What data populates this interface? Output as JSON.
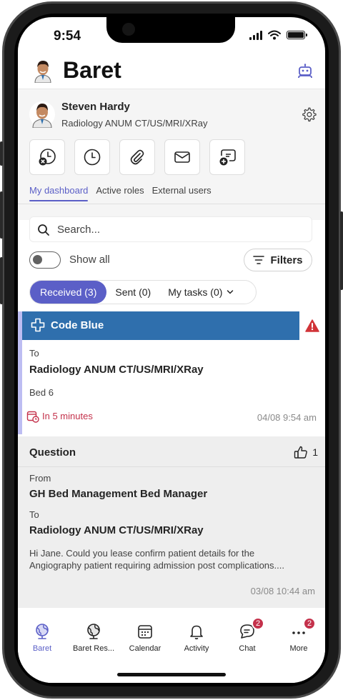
{
  "status_bar": {
    "time": "9:54"
  },
  "header": {
    "title": "Baret"
  },
  "profile": {
    "name": "Steven Hardy",
    "role": "Radiology ANUM CT/US/MRI/XRay"
  },
  "quick_actions": [
    "clock-cancel-icon",
    "clock-icon",
    "paperclip-icon",
    "mail-icon",
    "add-chat-icon"
  ],
  "tabs": [
    {
      "label": "My dashboard",
      "active": true
    },
    {
      "label": "Active roles",
      "active": false
    },
    {
      "label": "External users",
      "active": false
    }
  ],
  "search": {
    "placeholder": "Search..."
  },
  "filters": {
    "show_all_label": "Show all",
    "show_all_on": false,
    "filters_label": "Filters"
  },
  "segments": {
    "received": "Received (3)",
    "sent": "Sent (0)",
    "my_tasks": "My tasks (0)"
  },
  "cards": [
    {
      "title": "Code Blue",
      "header_color": "#2f6fad",
      "to_label": "To",
      "recipient": "Radiology ANUM CT/US/MRI/XRay",
      "detail": "Bed 6",
      "due": "In 5 minutes",
      "timestamp": "04/08 9:54 am"
    },
    {
      "title": "Question",
      "likes": "1",
      "from_label": "From",
      "sender": "GH Bed Management Bed Manager",
      "to_label": "To",
      "recipient": "Radiology ANUM CT/US/MRI/XRay",
      "message": "Hi Jane. Could you lease confirm patient details for the Angiography patient requiring admission post complications....",
      "timestamp": "03/08 10:44 am"
    }
  ],
  "bottom_nav": [
    {
      "label": "Baret",
      "icon": "globe-icon",
      "active": true
    },
    {
      "label": "Baret Res...",
      "icon": "globe-icon",
      "active": false
    },
    {
      "label": "Calendar",
      "icon": "calendar-icon",
      "active": false
    },
    {
      "label": "Activity",
      "icon": "bell-icon",
      "active": false
    },
    {
      "label": "Chat",
      "icon": "chat-icon",
      "badge": "2",
      "active": false
    },
    {
      "label": "More",
      "icon": "more-icon",
      "badge": "2",
      "active": false
    }
  ],
  "colors": {
    "accent": "#5b5fc7",
    "code_blue": "#2f6fad",
    "alert_red": "#d13438",
    "due_red": "#c4314b"
  }
}
